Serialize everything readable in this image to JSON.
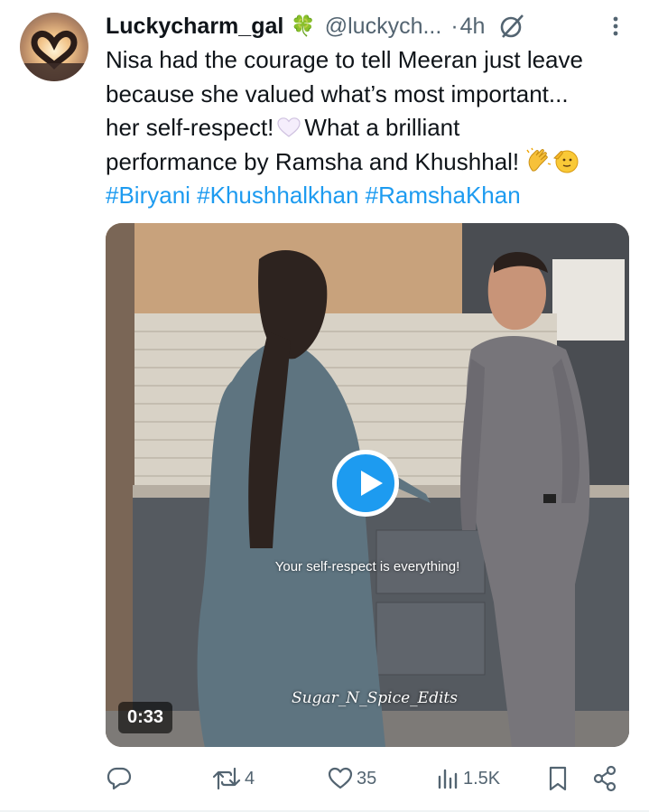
{
  "tweet": {
    "display_name": "Luckycharm_gal",
    "name_emoji": "🍀",
    "handle": "@luckych...",
    "separator": "·",
    "time": "4h",
    "text_lines": [
      "Nisa had the courage to tell Meeran just leave",
      "because she valued what’s most important...",
      "her self-respect!",
      "What a brilliant",
      "performance by Ramsha and Khushhal!"
    ],
    "hashtags": [
      "#Biryani",
      "#Khushhalkhan",
      "#RamshaKhan"
    ]
  },
  "media": {
    "caption": "Your self-respect is everything!",
    "watermark": "Sugar_N_Spice_Edits",
    "duration": "0:33"
  },
  "actions": {
    "reply_icon": "reply-icon",
    "retweet_count": "4",
    "like_count": "35",
    "views_count": "1.5K",
    "bookmark_icon": "bookmark-icon",
    "share_icon": "share-icon"
  },
  "colors": {
    "link": "#1d9bf0",
    "secondary_text": "#536471",
    "primary_text": "#0f1419"
  }
}
